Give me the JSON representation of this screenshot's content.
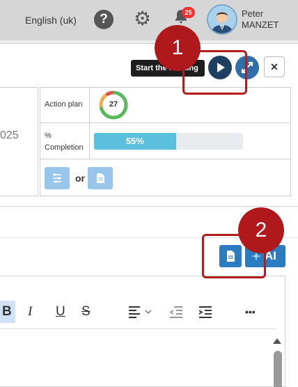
{
  "topbar": {
    "language": "English (uk)",
    "help_icon": "question-circle-icon",
    "settings_icon": "gear-icon",
    "notifications_icon": "bell-icon",
    "notification_count": "25",
    "user_first_name": "Peter",
    "user_last_name": "MANZET"
  },
  "toolbar_top": {
    "tooltip": "Start the meeting",
    "play_icon": "play-icon",
    "expand_icon": "expand-icon",
    "close_label": "✕"
  },
  "annotations": {
    "step1": "1",
    "step2": "2",
    "highlight_color": "#b11d1d"
  },
  "info": {
    "year_fragment": "025",
    "action_plan_label": "Action plan",
    "action_plan_count": "27",
    "completion_label_line1": "%",
    "completion_label_line2": "Completion",
    "completion_value": "55%",
    "completion_fraction": 0.55,
    "or_label": "or",
    "list_icon": "sliders-icon",
    "file_icon": "file-icon"
  },
  "actions": {
    "doc_icon": "file-text-icon",
    "ai_label": "AI",
    "ai_icon": "sparkle-icon"
  },
  "editor": {
    "bold": "B",
    "italic": "I",
    "underline": "U",
    "strike": "S",
    "align_icon": "align-left-icon",
    "outdent_icon": "outdent-icon",
    "indent_icon": "indent-icon",
    "more": "•••"
  },
  "colors": {
    "accent": "#2b7bc0",
    "progress": "#5bc0de",
    "ring_green": "#5cb85c",
    "ring_orange": "#f0ad4e",
    "ring_red": "#d9534f"
  }
}
